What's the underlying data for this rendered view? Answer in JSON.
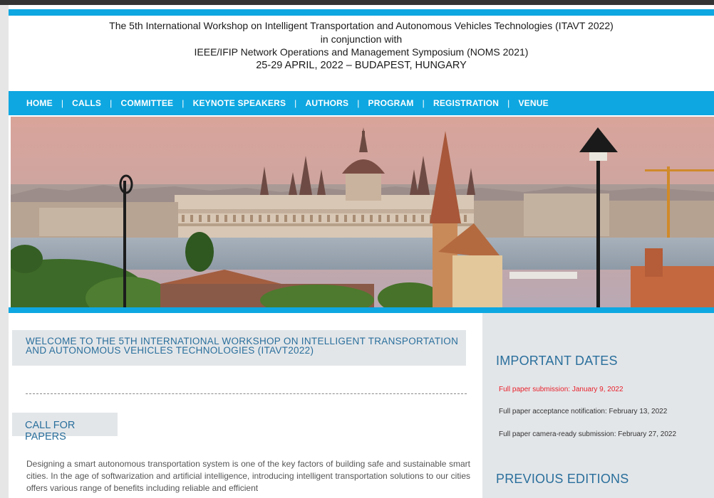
{
  "header": {
    "line1": "The 5th International Workshop on Intelligent Transportation and Autonomous Vehicles Technologies (ITAVT 2022)",
    "line2": "in conjunction with",
    "line3": "IEEE/IFIP Network Operations and Management Symposium (NOMS 2021)",
    "line4": "25-29 APRIL, 2022 – BUDAPEST, HUNGARY"
  },
  "nav": {
    "items": [
      "HOME",
      "CALLS",
      "COMMITTEE",
      "KEYNOTE SPEAKERS",
      "AUTHORS",
      "PROGRAM",
      "REGISTRATION",
      "VENUE"
    ],
    "separator": "|"
  },
  "main": {
    "welcome_title": "WELCOME TO THE 5TH INTERNATIONAL WORKSHOP ON INTELLIGENT TRANSPORTATION AND AUTONOMOUS VEHICLES TECHNOLOGIES (ITAVT2022)",
    "cfp_title": "CALL FOR PAPERS",
    "cfp_text": "Designing a smart autonomous transportation system is one of the key factors of building safe and sustainable smart cities. In the age of softwarization and artificial intelligence, introducing intelligent transportation solutions to our cities offers various range of benefits including reliable and efficient"
  },
  "sidebar": {
    "important_dates_title": "IMPORTANT DATES",
    "dates": [
      "Full paper submission: January 9, 2022",
      "Full paper acceptance notification: February 13, 2022",
      "Full paper camera-ready submission: February 27, 2022"
    ],
    "previous_editions_title": "PREVIOUS EDITIONS"
  },
  "colors": {
    "accent": "#0ea7e1",
    "heading": "#2a6f9c",
    "highlight_date": "#e8202a",
    "panel": "#e3e6e9"
  }
}
